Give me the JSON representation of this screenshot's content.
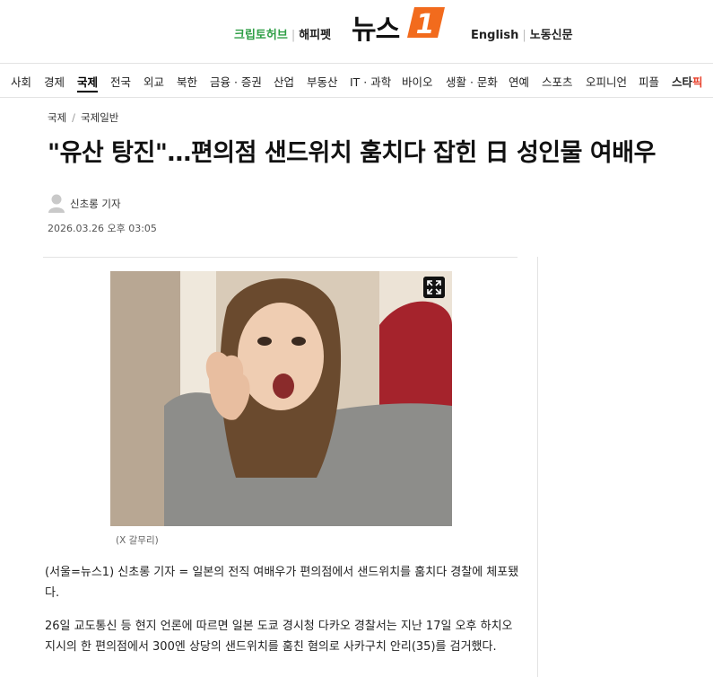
{
  "header": {
    "left_links": [
      "크립토허브",
      "해피펫"
    ],
    "logo_text": "뉴스",
    "logo_badge": "1",
    "right_links": [
      "English",
      "노동신문"
    ]
  },
  "nav": {
    "items": [
      "사회",
      "경제",
      "국제",
      "전국",
      "외교",
      "북한",
      "금융 · 증권",
      "산업",
      "부동산",
      "IT · 과학",
      "바이오",
      "생활 · 문화",
      "연예",
      "스포츠",
      "오피니언",
      "피플"
    ],
    "active": "국제",
    "star_prefix": "스타",
    "star_suffix": "픽"
  },
  "article": {
    "breadcrumb": [
      "국제",
      "국제일반"
    ],
    "title": "\"유산 탕진\"…편의점 샌드위치 훔치다 잡힌 日 성인물 여배우",
    "author": "신초롱 기자",
    "date": "2026.03.26 오후 03:05",
    "photo_caption": "(X 갈무리)",
    "paragraphs": [
      "(서울=뉴스1) 신초롱 기자 = 일본의 전직 여배우가 편의점에서 샌드위치를 훔치다 경찰에 체포됐다.",
      "26일 교도통신 등 현지 언론에 따르면 일본 도쿄 경시청 다카오 경찰서는 지난 17일 오후 하치오지시의 한 편의점에서 300엔 상당의 샌드위치를 훔친 혐의로 사카구치 안리(35)를 검거했다."
    ]
  },
  "colors": {
    "brand_orange": "#f26b1d",
    "link_green": "#2e9e45"
  }
}
